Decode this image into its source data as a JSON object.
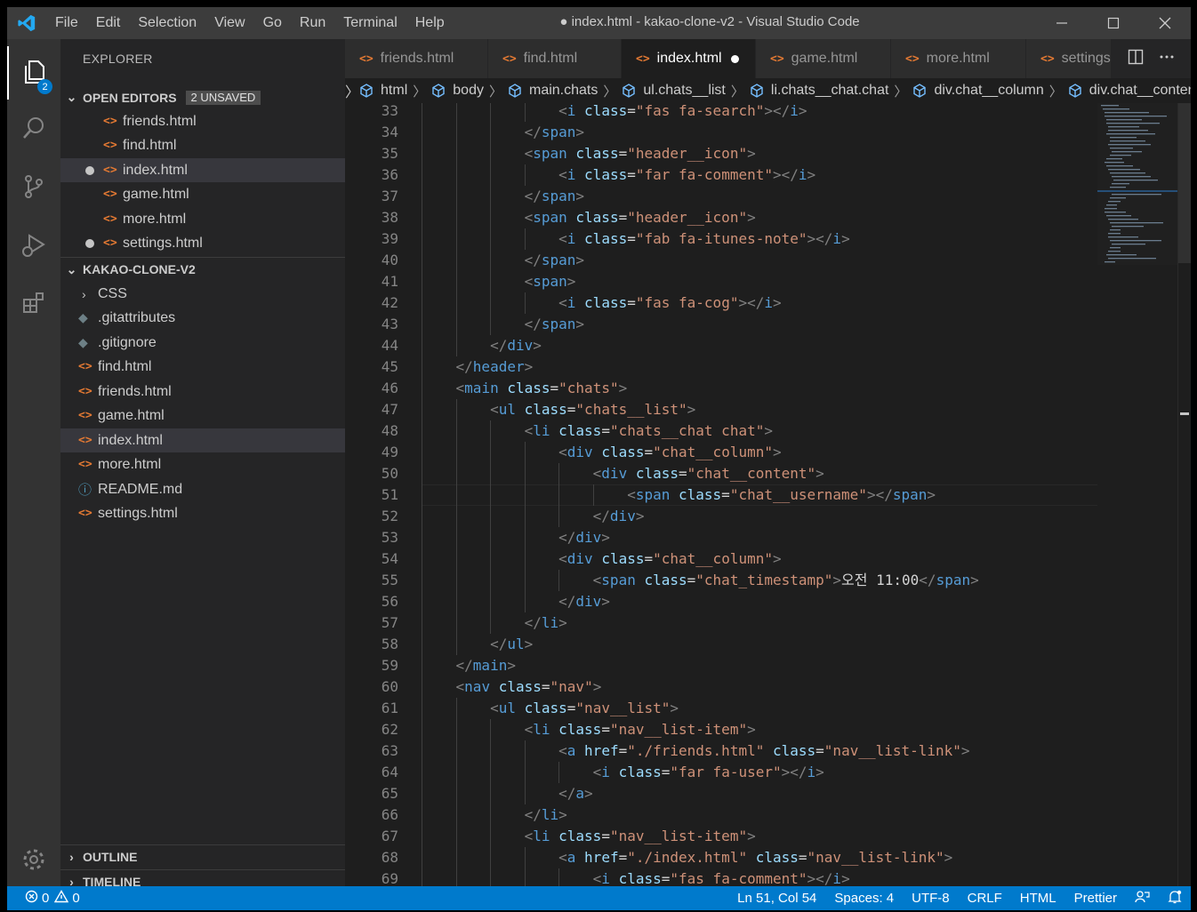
{
  "menu": [
    "File",
    "Edit",
    "Selection",
    "View",
    "Go",
    "Run",
    "Terminal",
    "Help"
  ],
  "window_title": "● index.html - kakao-clone-v2 - Visual Studio Code",
  "activity": {
    "explorer_badge": "2"
  },
  "sidebar": {
    "title": "EXPLORER",
    "open_editors": {
      "label": "OPEN EDITORS",
      "badge": "2 UNSAVED",
      "items": [
        "friends.html",
        "find.html",
        "index.html",
        "game.html",
        "more.html",
        "settings.html"
      ]
    },
    "project": {
      "label": "KAKAO-CLONE-V2",
      "items": [
        "CSS",
        ".gitattributes",
        ".gitignore",
        "find.html",
        "friends.html",
        "game.html",
        "index.html",
        "more.html",
        "README.md",
        "settings.html"
      ]
    },
    "outline": "OUTLINE",
    "timeline": "TIMELINE"
  },
  "tabs": [
    "friends.html",
    "find.html",
    "index.html",
    "game.html",
    "more.html",
    "settings.html"
  ],
  "breadcrumb": [
    "html",
    "body",
    "main.chats",
    "ul.chats__list",
    "li.chats__chat.chat",
    "div.chat__column",
    "div.chat__content"
  ],
  "code": {
    "line_numbers": [
      "33",
      "34",
      "35",
      "36",
      "37",
      "38",
      "39",
      "40",
      "41",
      "42",
      "43",
      "44",
      "45",
      "46",
      "47",
      "48",
      "49",
      "50",
      "51",
      "52",
      "53",
      "54",
      "55",
      "56",
      "57",
      "58",
      "59",
      "60",
      "61",
      "62",
      "63",
      "64",
      "65",
      "66",
      "67",
      "68",
      "69"
    ],
    "lines": [
      "                <i class=\"fas fa-search\"></i>",
      "            </span>",
      "            <span class=\"header__icon\">",
      "                <i class=\"far fa-comment\"></i>",
      "            </span>",
      "            <span class=\"header__icon\">",
      "                <i class=\"fab fa-itunes-note\"></i>",
      "            </span>",
      "            <span>",
      "                <i class=\"fas fa-cog\"></i>",
      "            </span>",
      "        </div>",
      "    </header>",
      "    <main class=\"chats\">",
      "        <ul class=\"chats__list\">",
      "            <li class=\"chats__chat chat\">",
      "                <div class=\"chat__column\">",
      "                    <div class=\"chat__content\">",
      "                        <span class=\"chat__username\"></span>",
      "                    </div>",
      "                </div>",
      "                <div class=\"chat__column\">",
      "                    <span class=\"chat_timestamp\">오전 11:00</span>",
      "                </div>",
      "            </li>",
      "        </ul>",
      "    </main>",
      "    <nav class=\"nav\">",
      "        <ul class=\"nav__list\">",
      "            <li class=\"nav__list-item\">",
      "                <a href=\"./friends.html\" class=\"nav__list-link\">",
      "                    <i class=\"far fa-user\"></i>",
      "                </a>",
      "            </li>",
      "            <li class=\"nav__list-item\">",
      "                <a href=\"./index.html\" class=\"nav__list-link\">",
      "                    <i class=\"fas fa-comment\"></i>"
    ]
  },
  "status": {
    "errors": "0",
    "warnings": "0",
    "position": "Ln 51, Col 54",
    "spaces": "Spaces: 4",
    "encoding": "UTF-8",
    "eol": "CRLF",
    "language": "HTML",
    "formatter": "Prettier"
  },
  "colors": {
    "accent": "#007acc",
    "html_icon": "#e37933",
    "tag": "#569cd6",
    "attr": "#9cdcfe",
    "string": "#ce9178"
  }
}
